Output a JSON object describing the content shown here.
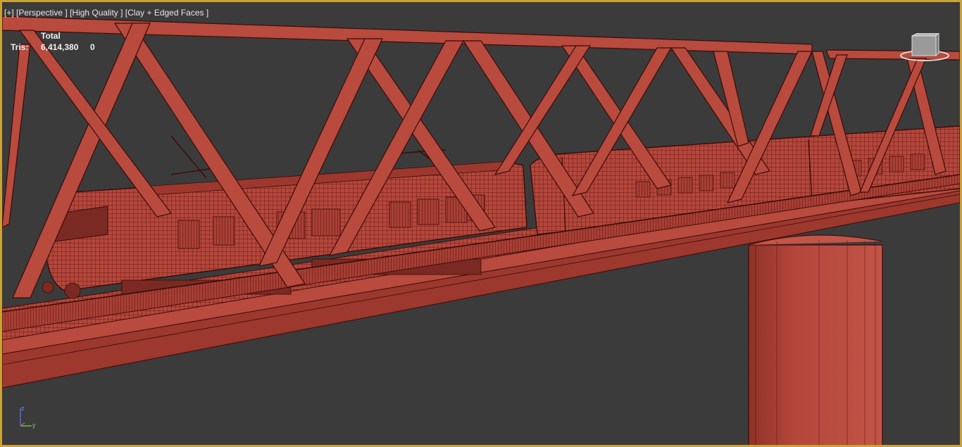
{
  "viewport": {
    "label_plus": "[+]",
    "label_view": "[Perspective ]",
    "label_quality": "[High Quality ]",
    "label_shading": "[Clay + Edged Faces ]"
  },
  "stats": {
    "column_header": "Total",
    "tris_label": "Tris:",
    "tris_total": "6,414,380",
    "tris_selected": "0"
  },
  "axis": {
    "z_label": "z",
    "y_label": "y"
  },
  "colors": {
    "background": "#3b3b3b",
    "clay": "#b5463b",
    "clay_light": "#c85a4c",
    "edge": "#3a0c08",
    "active_border": "#c9a23a"
  }
}
